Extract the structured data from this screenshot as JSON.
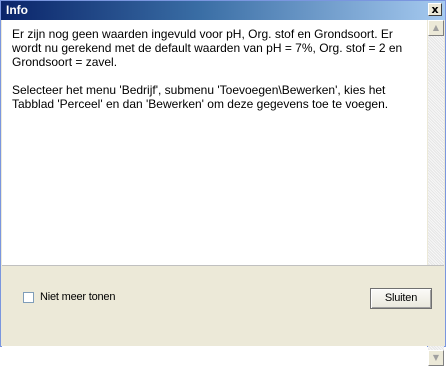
{
  "window": {
    "title": "Info",
    "close_glyph": "x"
  },
  "message": {
    "paragraphs": [
      "Er zijn nog geen waarden ingevuld voor pH, Org. stof en Grondsoort. Er wordt nu gerekend met de default waarden van pH = 7%, Org. stof = 2 en Grondsoort = zavel.",
      "Selecteer het menu 'Bedrijf', submenu 'Toevoegen\\Bewerken', kies het Tabblad 'Perceel' en dan 'Bewerken' om deze gegevens toe te voegen."
    ]
  },
  "scrollbar": {
    "up_glyph": "▲",
    "down_glyph": "▼"
  },
  "footer": {
    "checkbox_label": "Niet meer tonen",
    "checkbox_checked": false,
    "close_button_label": "Sluiten"
  },
  "colors": {
    "titlebar_start": "#0a246a",
    "titlebar_end": "#a6caf0",
    "dialog_face": "#ece9d8"
  },
  "icons": [
    "close-icon",
    "scroll-up-arrow-icon",
    "scroll-down-arrow-icon"
  ]
}
